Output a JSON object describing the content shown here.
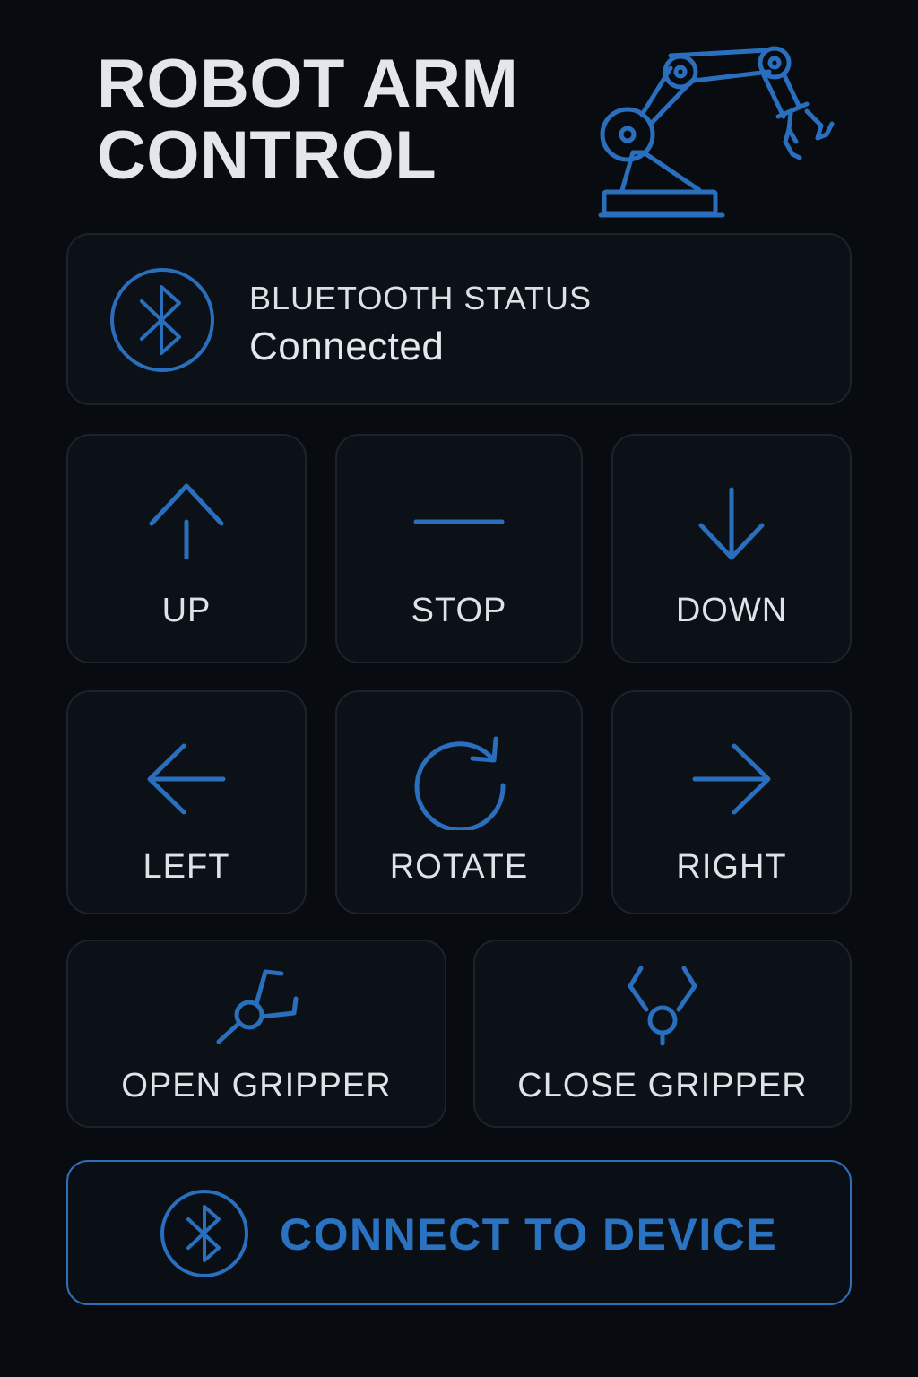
{
  "header": {
    "title_line1": "ROBOT ARM",
    "title_line2": "CONTROL",
    "illustration_icon": "robot-arm-icon"
  },
  "status": {
    "label": "BLUETOOTH STATUS",
    "value": "Connected",
    "icon": "bluetooth-icon"
  },
  "controls": {
    "up": {
      "label": "UP",
      "icon": "arrow-up-icon"
    },
    "stop": {
      "label": "STOP",
      "icon": "stop-line-icon"
    },
    "down": {
      "label": "DOWN",
      "icon": "arrow-down-icon"
    },
    "left": {
      "label": "LEFT",
      "icon": "arrow-left-icon"
    },
    "rotate": {
      "label": "ROTATE",
      "icon": "rotate-icon"
    },
    "right": {
      "label": "RIGHT",
      "icon": "arrow-right-icon"
    },
    "open_gripper": {
      "label": "OPEN GRIPPER",
      "icon": "gripper-open-icon"
    },
    "close_gripper": {
      "label": "CLOSE GRIPPER",
      "icon": "gripper-close-icon"
    }
  },
  "connect_button": {
    "label": "CONNECT TO DEVICE",
    "icon": "bluetooth-icon"
  },
  "colors": {
    "background": "#080b10",
    "card": "#0c1118",
    "card_border": "#1b232d",
    "accent": "#2a72c2",
    "text": "#dfe3e8"
  }
}
